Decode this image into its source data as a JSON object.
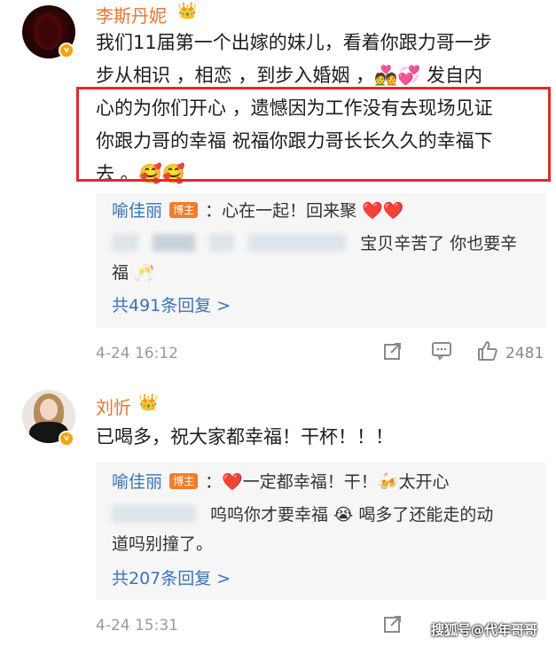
{
  "comments": [
    {
      "username": "李斯丹妮",
      "text_lines": [
        "我们11届第一个出嫁的妹儿，看着你跟力哥一步",
        "步从相识 ，相恋 ，到步入婚姻 ，💑💞 发自内",
        "心的为你们开心 ，遗憾因为工作没有去现场见证",
        "你跟力哥的幸福 祝福你跟力哥长长久久的幸福下",
        "去 。🥰🥰"
      ],
      "replies": [
        {
          "name": "喻佳丽",
          "badge": "博主",
          "text": "：心在一起！回来聚 ❤️❤️"
        }
      ],
      "reply_text_partial_1": "宝贝辛苦了 你也要辛",
      "reply_text_partial_2": "福 🥂",
      "more_replies": "共491条回复 >",
      "time": "4-24 16:12",
      "likes": "2481"
    },
    {
      "username": "刘忻",
      "text_lines": [
        "已喝多，祝大家都幸福！干杯！！！"
      ],
      "replies": [
        {
          "name": "喻佳丽",
          "badge": "博主",
          "text": "：❤️一定都幸福！干！🍻太开心"
        }
      ],
      "reply_text_partial_1": "呜呜你才要幸福 😭 喝多了还能走的动",
      "reply_text_partial_2": "道吗别撞了。",
      "more_replies": "共207条回复 >",
      "time": "4-24 15:31"
    }
  ],
  "watermark": "搜狐号@代年哥哥",
  "icons": {
    "crown": "crown-icon",
    "verified": "v-badge-icon",
    "share": "share-icon",
    "comment": "comment-icon",
    "like": "thumbs-up-icon"
  }
}
